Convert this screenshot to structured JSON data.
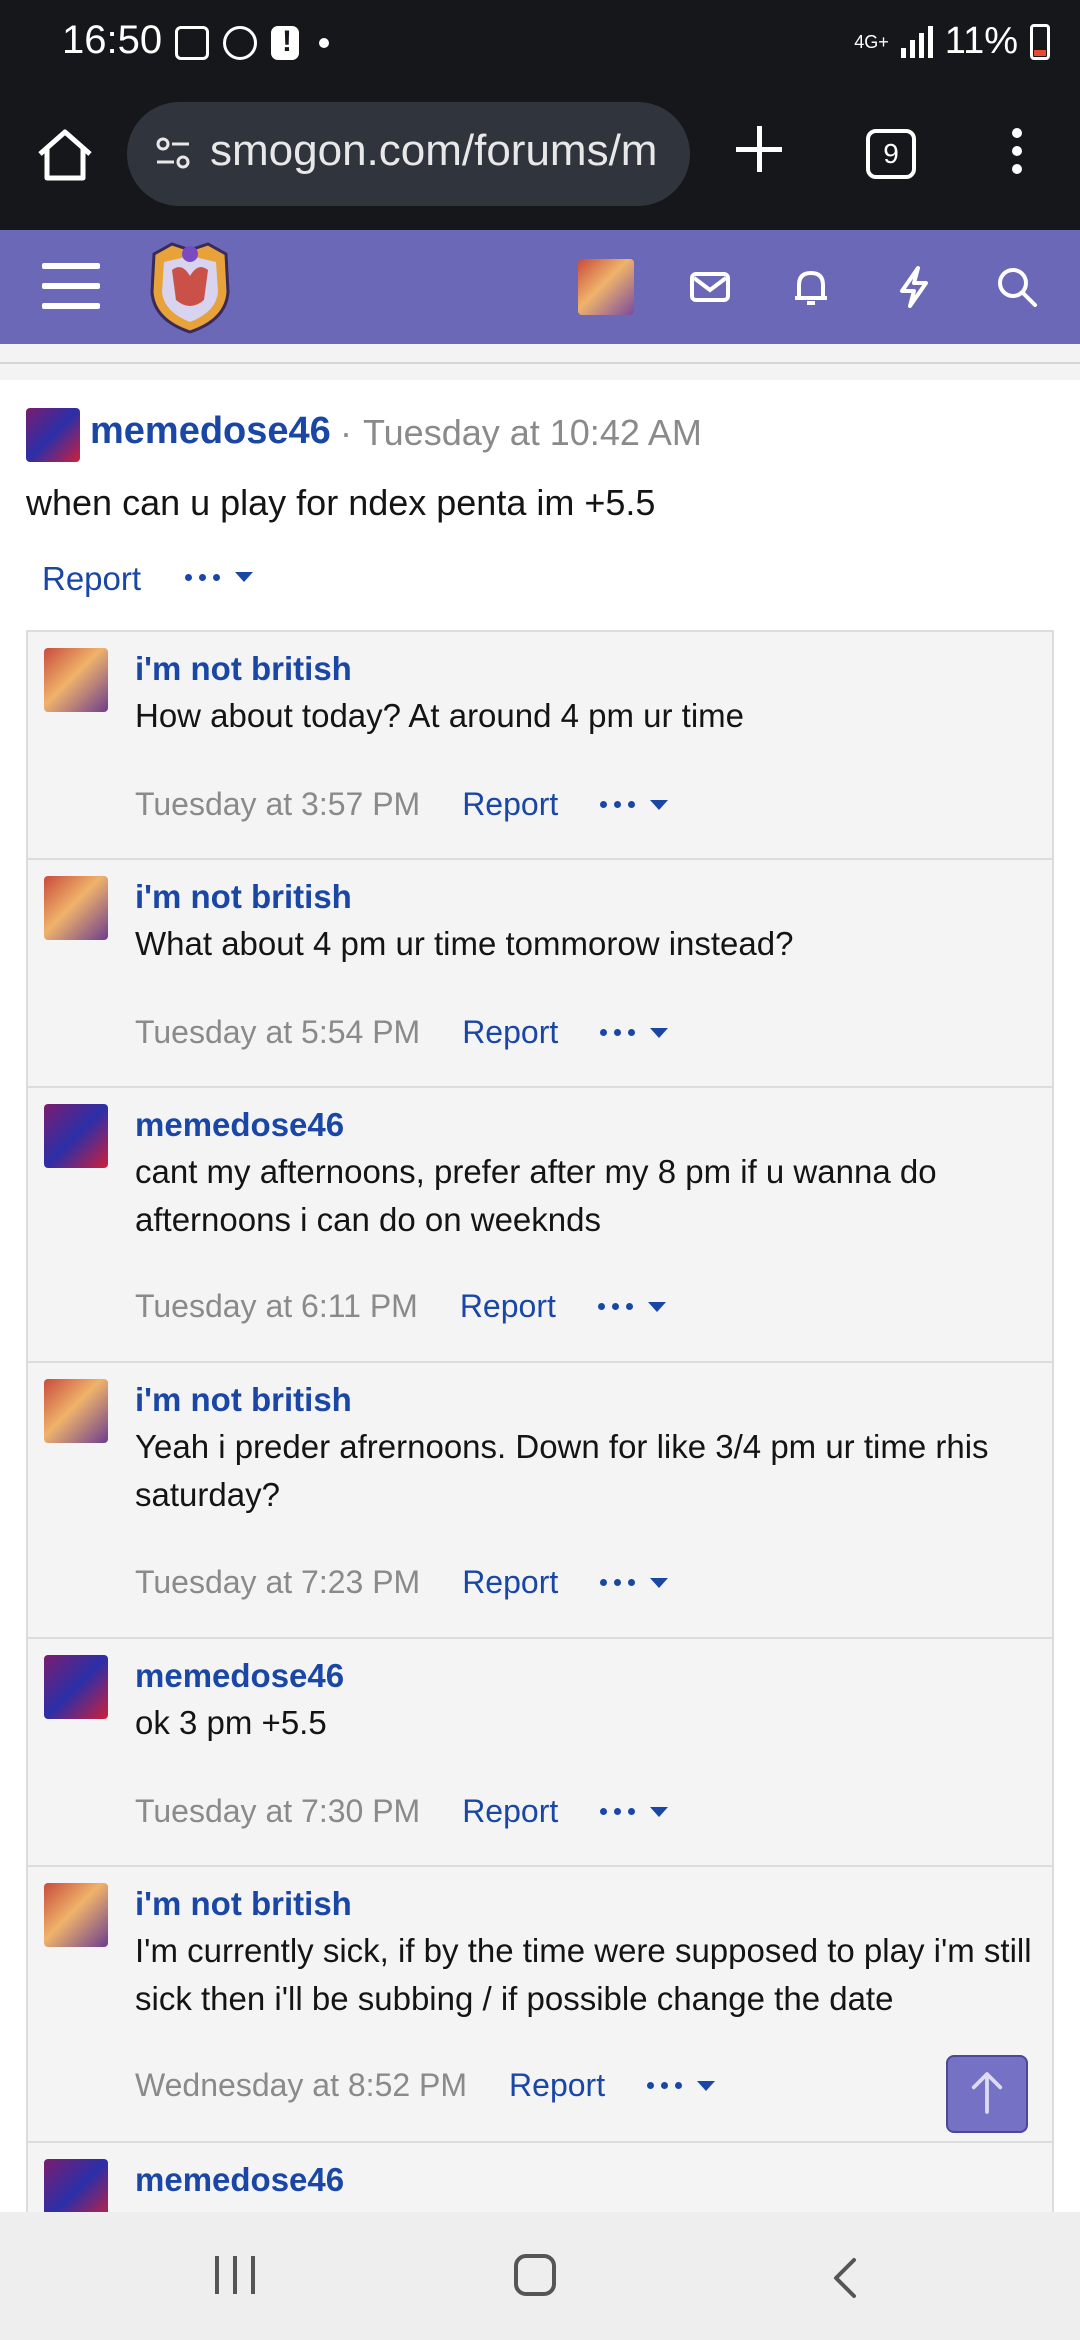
{
  "status_bar": {
    "time": "16:50",
    "network": "4G+",
    "battery": "11%"
  },
  "browser": {
    "url": "smogon.com/forums/m",
    "tab_count": "9"
  },
  "colors": {
    "forum_header": "#6c68b8",
    "username": "#1a47a6",
    "meta_gray": "#8a8a8a"
  },
  "post": {
    "author": "memedose46",
    "separator": "·",
    "timestamp": "Tuesday at 10:42 AM",
    "text": "when can u play for ndex penta im +5.5",
    "report_label": "Report"
  },
  "comments": [
    {
      "author": "i'm not british",
      "text": "How about today? At around 4 pm ur time",
      "timestamp": "Tuesday at 3:57 PM",
      "report_label": "Report"
    },
    {
      "author": "i'm not british",
      "text": "What about 4 pm ur time tommorow instead?",
      "timestamp": "Tuesday at 5:54 PM",
      "report_label": "Report"
    },
    {
      "author": "memedose46",
      "text": "cant my afternoons, prefer after my 8 pm if u wanna do afternoons i can do on weeknds",
      "timestamp": "Tuesday at 6:11 PM",
      "report_label": "Report"
    },
    {
      "author": "i'm not british",
      "text": "Yeah i preder afrernoons. Down for like 3/4 pm ur time rhis saturday?",
      "timestamp": "Tuesday at 7:23 PM",
      "report_label": "Report"
    },
    {
      "author": "memedose46",
      "text": "ok 3 pm +5.5",
      "timestamp": "Tuesday at 7:30 PM",
      "report_label": "Report"
    },
    {
      "author": "i'm not british",
      "text": "I'm currently sick, if by the time were supposed to play i'm still sick then i'll be subbing / if possible change the date",
      "timestamp": "Wednesday at 8:52 PM",
      "report_label": "Report"
    },
    {
      "author": "memedose46"
    }
  ]
}
